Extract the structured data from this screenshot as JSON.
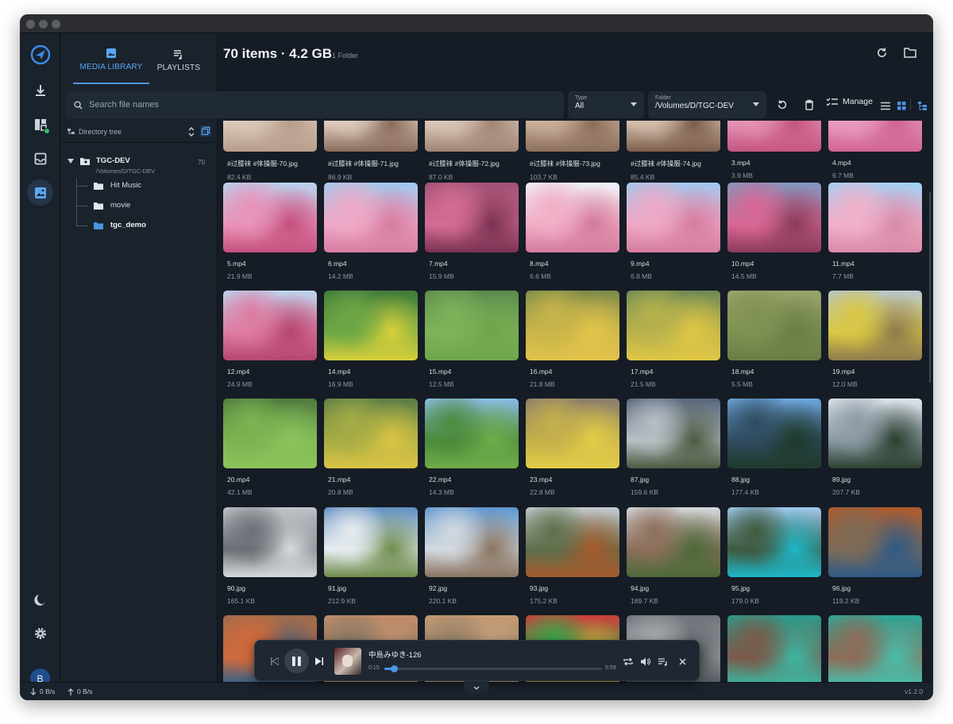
{
  "window": {
    "title": ""
  },
  "rail": {
    "items": [
      {
        "name": "download-icon"
      },
      {
        "name": "dashboard-icon"
      },
      {
        "name": "inbox-icon"
      },
      {
        "name": "media-library-icon"
      }
    ],
    "avatar_initial": "B"
  },
  "sidebar": {
    "tabs": [
      {
        "label": "MEDIA LIBRARY",
        "active": true
      },
      {
        "label": "PLAYLISTS",
        "active": false
      }
    ],
    "directory_tree_label": "Directory tree",
    "root": {
      "name": "TGC-DEV",
      "path": "/Volumes/D/TGC-DEV",
      "count": "70"
    },
    "folders": [
      "Hit Music",
      "movie",
      "tgc_demo"
    ]
  },
  "header": {
    "title": "70 items · 4.2 GB",
    "subtitle": "1 Folder"
  },
  "search": {
    "placeholder": "Search file names"
  },
  "filters": {
    "type": {
      "caption": "Type",
      "value": "All"
    },
    "folder": {
      "caption": "Folder",
      "value": "/Volumes/D/TGC-DEV"
    }
  },
  "toolbar": {
    "manage_label": "Manage"
  },
  "grid": {
    "items": [
      {
        "name": "#过膝袜 #体操服-70.jpg",
        "size": "82.4 KB",
        "thumb": [
          "#f0e7de",
          "#d9c6b8",
          "#b79c8a"
        ]
      },
      {
        "name": "#过膝袜 #体操服-71.jpg",
        "size": "86.9 KB",
        "thumb": [
          "#f2ebe4",
          "#dcc9bc",
          "#8a6b5a"
        ]
      },
      {
        "name": "#过膝袜 #体操服-72.jpg",
        "size": "87.0 KB",
        "thumb": [
          "#f1e9e2",
          "#d8c4b6",
          "#a08474"
        ]
      },
      {
        "name": "#过膝袜 #体操服-73.jpg",
        "size": "103.7 KB",
        "thumb": [
          "#e9ddd0",
          "#c7ad98",
          "#8b6e5a"
        ]
      },
      {
        "name": "#过膝袜 #体操服-74.jpg",
        "size": "85.4 KB",
        "thumb": [
          "#efe5db",
          "#d1bba9",
          "#7c5d4b"
        ]
      },
      {
        "name": "3.mp4",
        "size": "3.9 MB",
        "thumb": [
          "#b8d4ee",
          "#e58fb3",
          "#c4557f"
        ]
      },
      {
        "name": "4.mp4",
        "size": "6.7 MB",
        "thumb": [
          "#a9c9e9",
          "#ea9abd",
          "#cf6490"
        ]
      },
      {
        "name": "5.mp4",
        "size": "21.9 MB",
        "thumb": [
          "#b7d3ee",
          "#e992b7",
          "#c5507e"
        ]
      },
      {
        "name": "6.mp4",
        "size": "14.2 MB",
        "thumb": [
          "#9ec9f0",
          "#f0a9c6",
          "#d77ca1"
        ]
      },
      {
        "name": "7.mp4",
        "size": "15.9 MB",
        "thumb": [
          "#a05174",
          "#d46c94",
          "#7a3151"
        ]
      },
      {
        "name": "8.mp4",
        "size": "6.6 MB",
        "thumb": [
          "#eef3f8",
          "#f1adc6",
          "#d47b9d"
        ]
      },
      {
        "name": "9.mp4",
        "size": "6.8 MB",
        "thumb": [
          "#9fc8ef",
          "#efa8c4",
          "#d57c9f"
        ]
      },
      {
        "name": "10.mp4",
        "size": "14.5 MB",
        "thumb": [
          "#7f98c0",
          "#d86693",
          "#8a3b5a"
        ]
      },
      {
        "name": "11.mp4",
        "size": "7.7 MB",
        "thumb": [
          "#9fd0f4",
          "#f2b0c9",
          "#d88aa8"
        ]
      },
      {
        "name": "12.mp4",
        "size": "24.9 MB",
        "thumb": [
          "#bcd6ef",
          "#de7aa0",
          "#b6466f"
        ]
      },
      {
        "name": "14.mp4",
        "size": "16.9 MB",
        "thumb": [
          "#3f7a3b",
          "#6ea845",
          "#d8cf3a"
        ]
      },
      {
        "name": "15.mp4",
        "size": "12.5 MB",
        "thumb": [
          "#5a8c4f",
          "#7fb259",
          "#6ea54c"
        ]
      },
      {
        "name": "16.mp4",
        "size": "21.8 MB",
        "thumb": [
          "#7c8a4a",
          "#c9b54a",
          "#e2c34a"
        ]
      },
      {
        "name": "17.mp4",
        "size": "21.5 MB",
        "thumb": [
          "#6e8a55",
          "#b8b24c",
          "#e0c645"
        ]
      },
      {
        "name": "18.mp4",
        "size": "5.5 MB",
        "thumb": [
          "#97a46a",
          "#7f9152",
          "#6b7d45"
        ]
      },
      {
        "name": "19.mp4",
        "size": "12.0 MB",
        "thumb": [
          "#b7c6cf",
          "#d8c742",
          "#8f7a4e"
        ]
      },
      {
        "name": "20.mp4",
        "size": "42.1 MB",
        "thumb": [
          "#4f7a3e",
          "#7db451",
          "#8cc35c"
        ]
      },
      {
        "name": "21.mp4",
        "size": "20.8 MB",
        "thumb": [
          "#5b7d45",
          "#a7ad45",
          "#d9c444"
        ]
      },
      {
        "name": "22.mp4",
        "size": "14.3 MB",
        "thumb": [
          "#8bbde8",
          "#4c8a3c",
          "#6fac4b"
        ]
      },
      {
        "name": "23.mp4",
        "size": "22.8 MB",
        "thumb": [
          "#8b7c6e",
          "#c4b04a",
          "#e3cc48"
        ]
      },
      {
        "name": "87.jpg",
        "size": "159.6 KB",
        "thumb": [
          "#56657a",
          "#b8bec5",
          "#4b5a40"
        ]
      },
      {
        "name": "88.jpg",
        "size": "177.4 KB",
        "thumb": [
          "#6da6dc",
          "#2f4b5f",
          "#1f3a2a"
        ]
      },
      {
        "name": "89.jpg",
        "size": "207.7 KB",
        "thumb": [
          "#dfe4ea",
          "#8a99a4",
          "#2c4030"
        ]
      },
      {
        "name": "90.jpg",
        "size": "165.1 KB",
        "thumb": [
          "#c2c6cb",
          "#6b7076",
          "#d7dadd"
        ]
      },
      {
        "name": "91.jpg",
        "size": "212.9 KB",
        "thumb": [
          "#5f8fc0",
          "#e7ecf0",
          "#6f8c4d"
        ]
      },
      {
        "name": "92.jpg",
        "size": "220.1 KB",
        "thumb": [
          "#5d95d0",
          "#d2d9df",
          "#8a7460"
        ]
      },
      {
        "name": "93.jpg",
        "size": "175.2 KB",
        "thumb": [
          "#c6cbd0",
          "#5f6f4b",
          "#a45a2b"
        ]
      },
      {
        "name": "94.jpg",
        "size": "189.7 KB",
        "thumb": [
          "#d5d9dd",
          "#8c6e5a",
          "#4c6a3a"
        ]
      },
      {
        "name": "95.jpg",
        "size": "179.0 KB",
        "thumb": [
          "#9fc9ee",
          "#3f5a3f",
          "#1eb7c9"
        ]
      },
      {
        "name": "96.jpg",
        "size": "119.2 KB",
        "thumb": [
          "#b05a2e",
          "#7d6b57",
          "#2f5a86"
        ]
      },
      {
        "name": "",
        "size": "",
        "thumb": [
          "#9a6b4e",
          "#d06a3c",
          "#2d5f8a"
        ]
      },
      {
        "name": "",
        "size": "",
        "thumb": [
          "#c28c6a",
          "#8e7b66",
          "#d4a077"
        ]
      },
      {
        "name": "",
        "size": "",
        "thumb": [
          "#c79a72",
          "#9a856c",
          "#d8b08a"
        ]
      },
      {
        "name": "",
        "size": "",
        "thumb": [
          "#cf3f3a",
          "#3aa64a",
          "#e8b93c"
        ]
      },
      {
        "name": "",
        "size": "",
        "thumb": [
          "#6d7278",
          "#a6abaf",
          "#4d5459"
        ]
      },
      {
        "name": "",
        "size": "",
        "thumb": [
          "#2a9c8c",
          "#7a5a4a",
          "#3bb8a4"
        ]
      },
      {
        "name": "",
        "size": "",
        "thumb": [
          "#2aa798",
          "#8c6c58",
          "#46c0ad"
        ]
      }
    ]
  },
  "player": {
    "title": "中島みゆき-126",
    "current_time": "0:15",
    "duration": "5:59",
    "progress": 0.042
  },
  "status": {
    "down": "0 B/s",
    "up": "0 B/s",
    "version": "v1.2.0"
  }
}
